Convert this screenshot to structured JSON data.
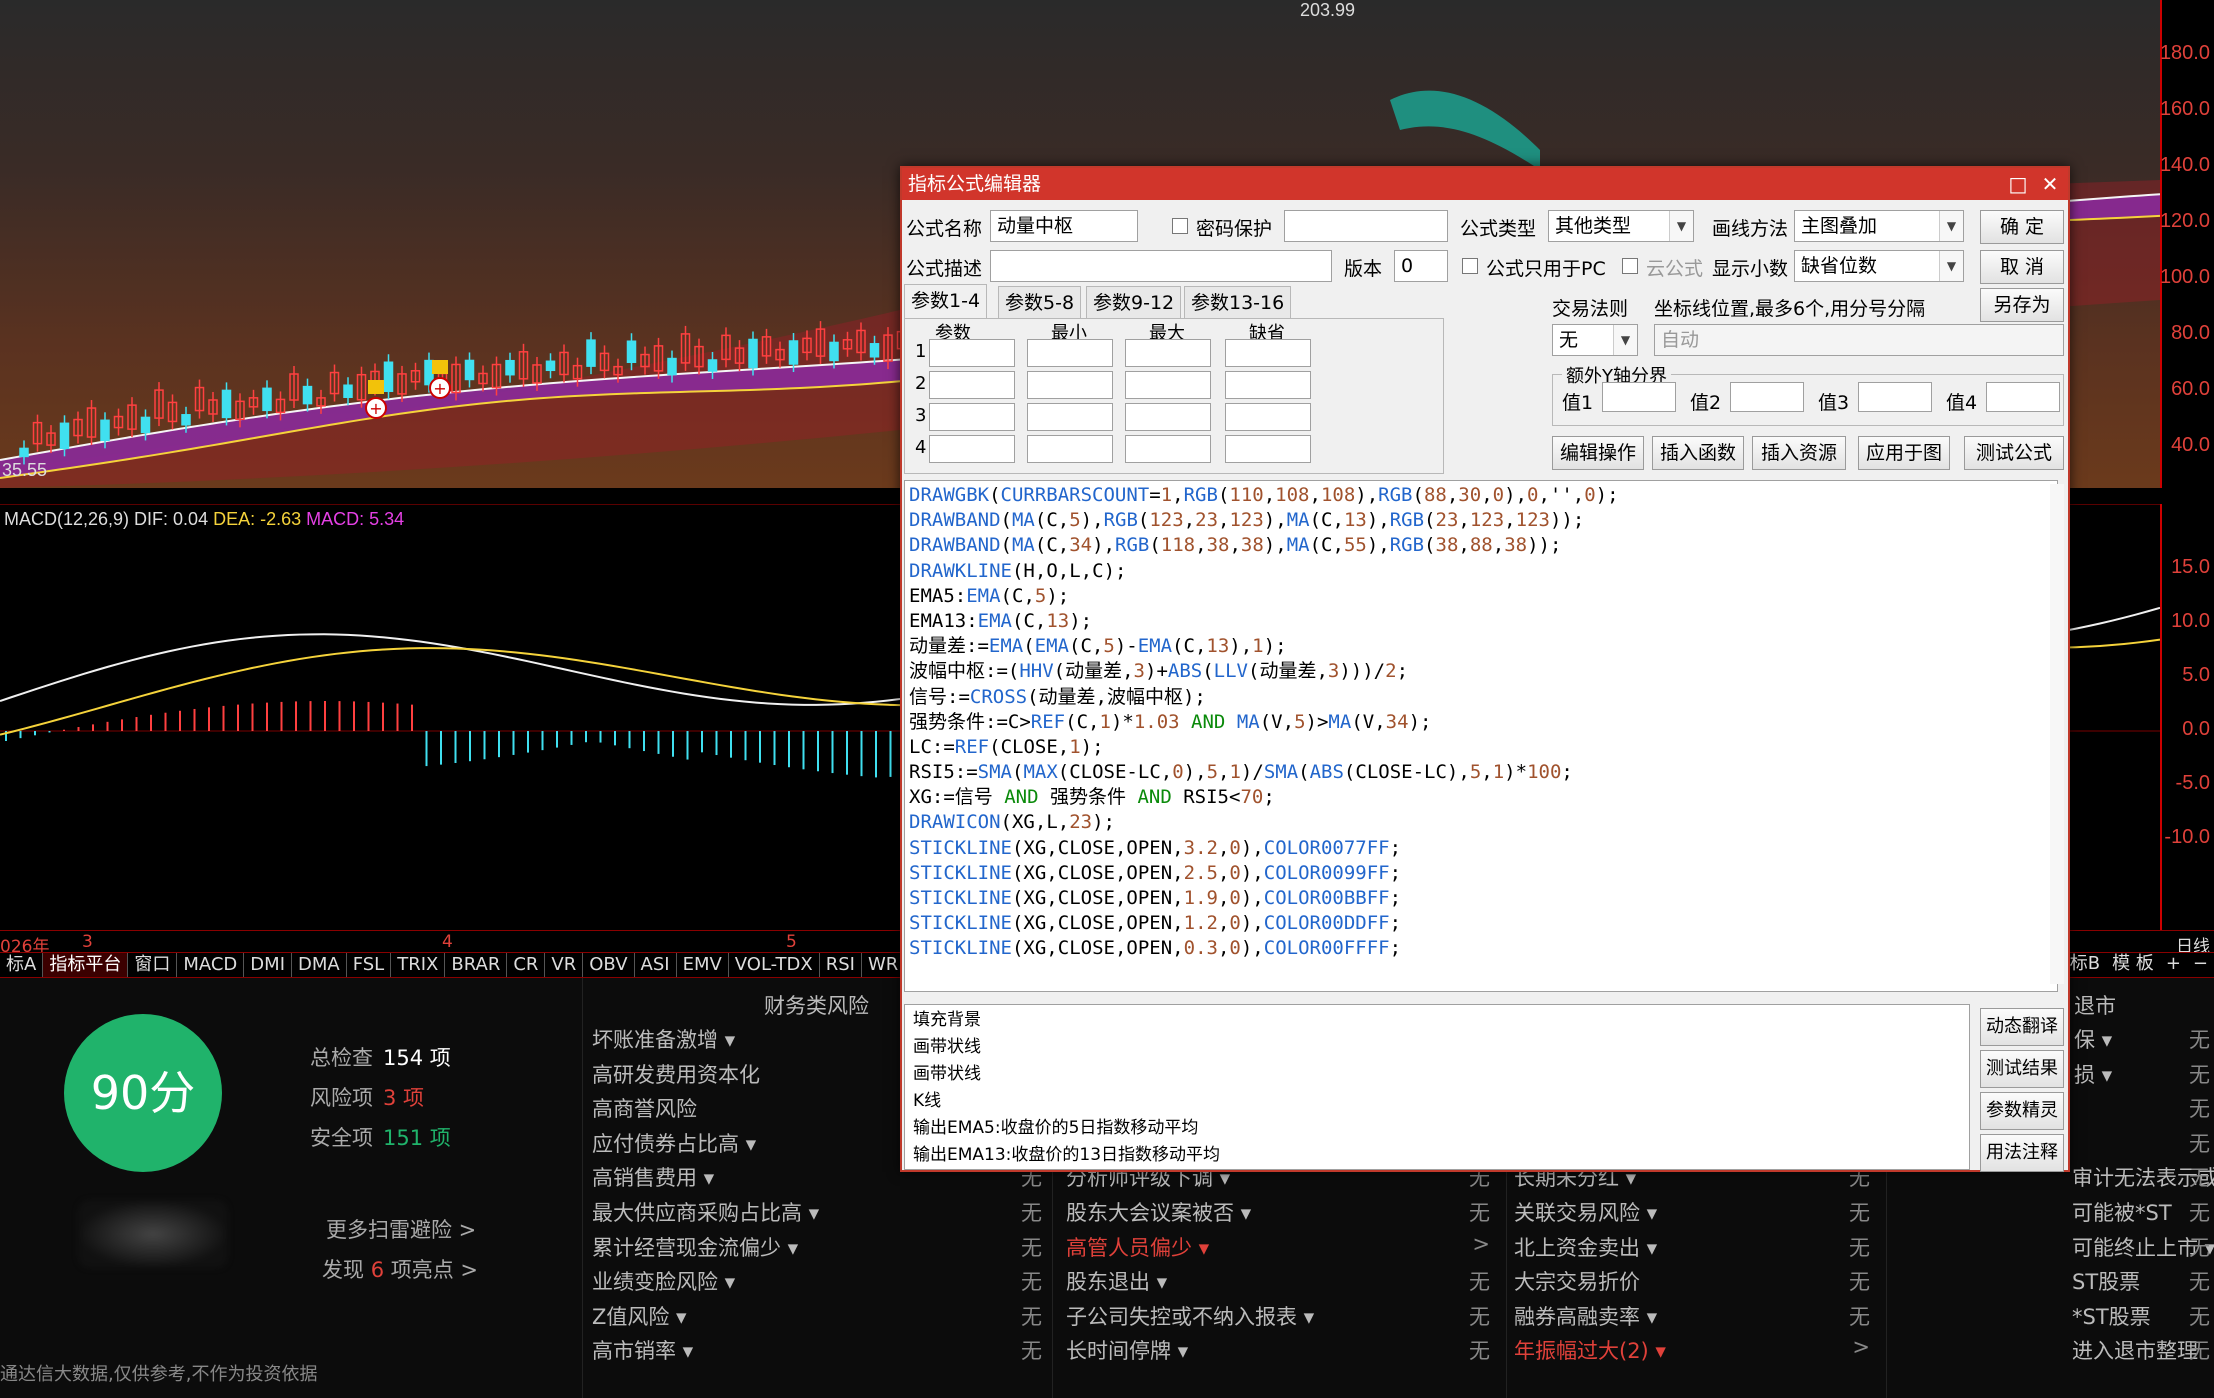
{
  "price_chart": {
    "high_label": "203.99",
    "low_label": "35.55",
    "axis_ticks": [
      "180.0",
      "160.0",
      "140.0",
      "120.0",
      "100.0",
      "80.0",
      "60.0",
      "40.0"
    ]
  },
  "macd": {
    "header_prefix": "MACD(12,26,9) DIF: 0.04",
    "dea": "DEA: -2.63",
    "macd": "MACD: 5.34",
    "axis_ticks": [
      "15.0",
      "10.0",
      "5.0",
      "0.0",
      "-5.0",
      "-10.0"
    ]
  },
  "time_axis": {
    "labels": [
      "026年",
      "3",
      "4",
      "5"
    ],
    "right_label": "日线"
  },
  "tabs": [
    "标A",
    "指标平台",
    "窗口",
    "MACD",
    "DMI",
    "DMA",
    "FSL",
    "TRIX",
    "BRAR",
    "CR",
    "VR",
    "OBV",
    "ASI",
    "EMV",
    "VOL-TDX",
    "RSI",
    "WR"
  ],
  "tabs_right": [
    "标B",
    "模 板",
    "+",
    "−"
  ],
  "risk": {
    "score": "90分",
    "total_label": "总检查",
    "total_value": "154 项",
    "risk_label": "风险项",
    "risk_value": "3 项",
    "safe_label": "安全项",
    "safe_value": "151 项",
    "more_link": "更多扫雷避险 >",
    "highlight_prefix": "发现",
    "highlight_count": "6",
    "highlight_suffix": "项亮点 >",
    "footer": "通达信大数据,仅供参考,不作为投资依据",
    "col1_title": "财务类风险",
    "col4_title": "退市",
    "col1": [
      {
        "label": "坏账准备激增 ▾",
        "value": ""
      },
      {
        "label": "高研发费用资本化",
        "value": ""
      },
      {
        "label": "高商誉风险",
        "value": ""
      },
      {
        "label": "应付债券占比高 ▾",
        "value": ""
      },
      {
        "label": "高销售费用 ▾",
        "value": "无"
      },
      {
        "label": "最大供应商采购占比高 ▾",
        "value": "无"
      },
      {
        "label": "累计经营现金流偏少 ▾",
        "value": "无"
      },
      {
        "label": "业绩变脸风险 ▾",
        "value": "无"
      },
      {
        "label": "Z值风险 ▾",
        "value": "无"
      },
      {
        "label": "高市销率 ▾",
        "value": "无"
      }
    ],
    "col2": [
      {
        "label": "分析师评级下调 ▾",
        "value": "无",
        "red": false
      },
      {
        "label": "股东大会议案被否 ▾",
        "value": "无",
        "red": false
      },
      {
        "label": "高管人员偏少 ▾",
        "value": ">",
        "red": true
      },
      {
        "label": "股东退出 ▾",
        "value": "无",
        "red": false
      },
      {
        "label": "子公司失控或不纳入报表 ▾",
        "value": "无",
        "red": false
      },
      {
        "label": "长时间停牌 ▾",
        "value": "无",
        "red": false
      }
    ],
    "col3": [
      {
        "label": "长期未分红 ▾",
        "value": "无",
        "red": false
      },
      {
        "label": "关联交易风险 ▾",
        "value": "无",
        "red": false
      },
      {
        "label": "北上资金卖出 ▾",
        "value": "无",
        "red": false
      },
      {
        "label": "大宗交易折价",
        "value": "无",
        "red": false
      },
      {
        "label": "融券高融卖率 ▾",
        "value": "无",
        "red": false
      },
      {
        "label": "年振幅过大(2) ▾",
        "value": ">",
        "red": true
      }
    ],
    "col4": [
      {
        "label": "保 ▾",
        "value": "无"
      },
      {
        "label": "损 ▾",
        "value": "无"
      },
      {
        "label": "",
        "value": "无"
      },
      {
        "label": "",
        "value": "无"
      },
      {
        "label": "审计无法表示或否定",
        "value": "无"
      },
      {
        "label": "可能被*ST",
        "value": "无"
      },
      {
        "label": "可能终止上市 ▾",
        "value": "无"
      },
      {
        "label": "ST股票",
        "value": "无"
      },
      {
        "label": "*ST股票",
        "value": "无"
      },
      {
        "label": "进入退市整理",
        "value": "无"
      }
    ]
  },
  "dialog": {
    "title": "指标公式编辑器",
    "name_label": "公式名称",
    "name_value": "动量中枢",
    "pwd_label": "密码保护",
    "type_label": "公式类型",
    "type_value": "其他类型",
    "draw_label": "画线方法",
    "draw_value": "主图叠加",
    "confirm": "确  定",
    "cancel": "取  消",
    "save_as": "另存为",
    "desc_label": "公式描述",
    "version_label": "版本",
    "version_value": "0",
    "pc_only": "公式只用于PC",
    "cloud": "云公式",
    "decimal_label": "显示小数",
    "decimal_value": "缺省位数",
    "tabs": [
      "参数1-4",
      "参数5-8",
      "参数9-12",
      "参数13-16"
    ],
    "param_headers": [
      "参数",
      "最小",
      "最大",
      "缺省"
    ],
    "param_rows": [
      "1",
      "2",
      "3",
      "4"
    ],
    "trade_rule_label": "交易法则",
    "trade_rule_value": "无",
    "coord_label": "坐标线位置,最多6个,用分号分隔",
    "coord_value": "自动",
    "extra_y_label": "额外Y轴分界",
    "val_labels": [
      "值1",
      "值2",
      "值3",
      "值4"
    ],
    "buttons": [
      "编辑操作",
      "插入函数",
      "插入资源",
      "应用于图",
      "测试公式"
    ],
    "side_buttons": [
      "动态翻译",
      "测试结果",
      "参数精灵",
      "用法注释"
    ],
    "output_lines": [
      "填充背景",
      "画带状线",
      "画带状线",
      "K线",
      "输出EMA5:收盘价的5日指数移动平均",
      "输出EMA13:收盘价的13日指数移动平均"
    ],
    "code_lines": [
      "DRAWGBK(CURRBARSCOUNT=1,RGB(110,108,108),RGB(88,30,0),0,'',0);",
      "DRAWBAND(MA(C,5),RGB(123,23,123),MA(C,13),RGB(23,123,123));",
      "DRAWBAND(MA(C,34),RGB(118,38,38),MA(C,55),RGB(38,88,38));",
      "DRAWKLINE(H,O,L,C);",
      "EMA5:EMA(C,5);",
      "EMA13:EMA(C,13);",
      "动量差:=EMA(EMA(C,5)-EMA(C,13),1);",
      "波幅中枢:=(HHV(动量差,3)+ABS(LLV(动量差,3)))/2;",
      "信号:=CROSS(动量差,波幅中枢);",
      "强势条件:=C>REF(C,1)*1.03 AND MA(V,5)>MA(V,34);",
      "LC:=REF(CLOSE,1);",
      "RSI5:=SMA(MAX(CLOSE-LC,0),5,1)/SMA(ABS(CLOSE-LC),5,1)*100;",
      "XG:=信号 AND 强势条件 AND RSI5<70;",
      "DRAWICON(XG,L,23);",
      "STICKLINE(XG,CLOSE,OPEN,3.2,0),COLOR0077FF;",
      "STICKLINE(XG,CLOSE,OPEN,2.5,0),COLOR0099FF;",
      "STICKLINE(XG,CLOSE,OPEN,1.9,0),COLOR00BBFF;",
      "STICKLINE(XG,CLOSE,OPEN,1.2,0),COLOR00DDFF;",
      "STICKLINE(XG,CLOSE,OPEN,0.3,0),COLOR00FFFF;"
    ]
  },
  "colors": {
    "accent_red": "#d1352b",
    "green_score": "#20b36b",
    "axis_red": "#e0413a"
  }
}
